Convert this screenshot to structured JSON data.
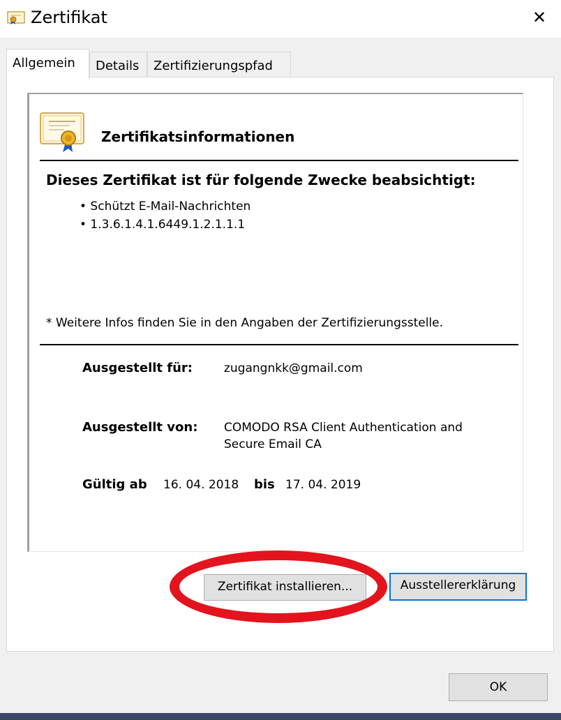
{
  "window": {
    "title": "Zertifikat",
    "close_glyph": "✕"
  },
  "tabs": [
    {
      "label": "Allgemein",
      "active": true
    },
    {
      "label": "Details",
      "active": false
    },
    {
      "label": "Zertifizierungspfad",
      "active": false
    }
  ],
  "info": {
    "heading": "Zertifikatsinformationen",
    "purposes_title": "Dieses Zertifikat ist für folgende Zwecke beabsichtigt:",
    "purposes": [
      "• Schützt E-Mail-Nachrichten",
      "• 1.3.6.1.4.1.6449.1.2.1.1.1"
    ],
    "note": "* Weitere Infos finden Sie in den Angaben der Zertifizierungsstelle.",
    "issued_to_label": "Ausgestellt für:",
    "issued_to_value": "zugangnkk@gmail.com",
    "issued_by_label": "Ausgestellt von:",
    "issued_by_value_line1": "COMODO RSA Client Authentication and",
    "issued_by_value_line2": "Secure Email CA",
    "valid_from_label": "Gültig ab",
    "valid_from_value": "16. 04. 2018",
    "valid_to_label": "bis",
    "valid_to_value": "17. 04. 2019"
  },
  "buttons": {
    "install": "Zertifikat installieren...",
    "issuer_statement": "Ausstellererklärung",
    "ok": "OK"
  },
  "icons": {
    "title": "certificate-icon",
    "info": "certificate-ribbon-icon",
    "close": "close-icon"
  },
  "colors": {
    "highlight_ellipse": "#e3141d",
    "focus_border": "#0078d7"
  }
}
